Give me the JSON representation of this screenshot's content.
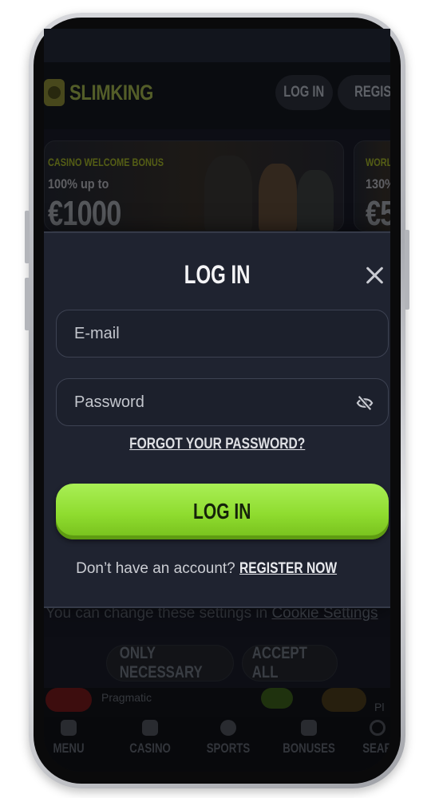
{
  "header": {
    "logo_text": "SLIMKING",
    "login_label": "LOG IN",
    "register_label": "REGISTE"
  },
  "promos": [
    {
      "tag": "CASINO WELCOME BONUS",
      "subtitle": "100% up to",
      "amount": "€1000"
    },
    {
      "tag": "WORL",
      "subtitle": "130%",
      "amount": "€5"
    }
  ],
  "cookie": {
    "text": "You can change these settings in ",
    "link": "Cookie Settings",
    "only_necessary_label": "ONLY NECESSARY",
    "accept_all_label": "ACCEPT ALL"
  },
  "games_strip": {
    "provider": "Pragmatic",
    "tail": "Pl"
  },
  "bottom_nav": {
    "items": [
      {
        "label": "MENU",
        "icon": "menu-icon"
      },
      {
        "label": "CASINO",
        "icon": "casino-icon"
      },
      {
        "label": "SPORTS",
        "icon": "sports-icon"
      },
      {
        "label": "BONUSES",
        "icon": "gift-icon"
      },
      {
        "label": "SEAR",
        "icon": "search-icon"
      }
    ]
  },
  "login_modal": {
    "title": "LOG IN",
    "email_placeholder": "E-mail",
    "password_placeholder": "Password",
    "forgot_label": "FORGOT YOUR PASSWORD?",
    "submit_label": "LOG IN",
    "no_account_text": "Don’t have an account? ",
    "register_link": "REGISTER NOW"
  },
  "colors": {
    "accent_green": "#8fdc2f",
    "modal_bg": "#1f2330",
    "page_bg": "#141620"
  }
}
